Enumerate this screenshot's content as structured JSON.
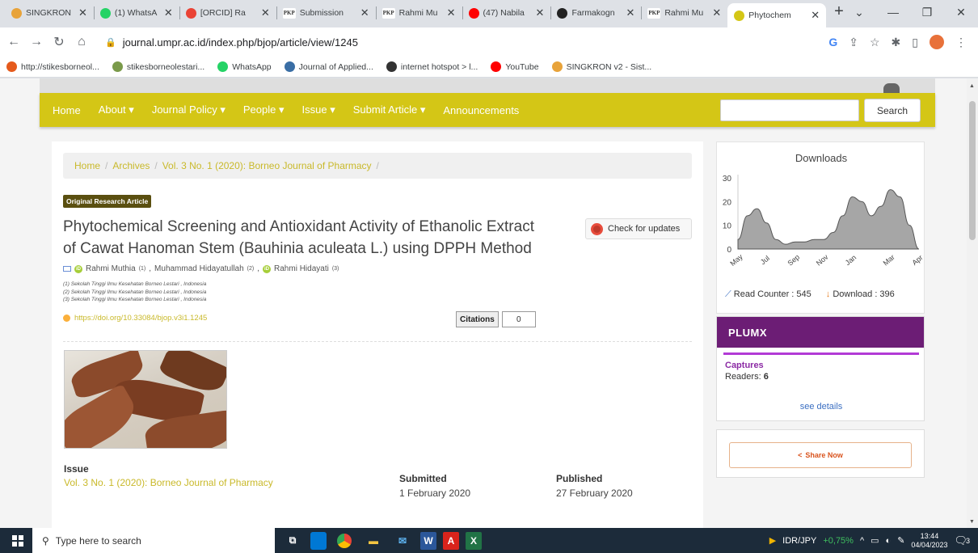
{
  "browser": {
    "tabs": [
      {
        "label": "SINGKRON",
        "icon": "singkron-icon",
        "color": "#e8a33a"
      },
      {
        "label": "(1) WhatsA",
        "icon": "whatsapp-icon",
        "color": "#25d366"
      },
      {
        "label": "[ORCID] Ra",
        "icon": "gmail-icon",
        "color": "#ea4335"
      },
      {
        "label": "Submission",
        "icon": "pkp-icon",
        "color": "#333333"
      },
      {
        "label": "Rahmi Mu",
        "icon": "pkp-icon",
        "color": "#333333"
      },
      {
        "label": "(47) Nabila",
        "icon": "youtube-icon",
        "color": "#ff0000"
      },
      {
        "label": "Farmakogn",
        "icon": "s-icon",
        "color": "#222222"
      },
      {
        "label": "Rahmi Mu",
        "icon": "pkp-icon",
        "color": "#333333"
      },
      {
        "label": "Phytochem",
        "icon": "journal-icon",
        "color": "#d4c616"
      }
    ],
    "url": "journal.umpr.ac.id/index.php/bjop/article/view/1245",
    "bookmarks": [
      {
        "label": "http://stikesborneol...",
        "icon": "cp-icon"
      },
      {
        "label": "stikesborneolestari...",
        "icon": "globe-icon"
      },
      {
        "label": "WhatsApp",
        "icon": "whatsapp-icon"
      },
      {
        "label": "Journal of Applied...",
        "icon": "journal-icon"
      },
      {
        "label": "internet hotspot > l...",
        "icon": "mikrotik-icon"
      },
      {
        "label": "YouTube",
        "icon": "youtube-icon"
      },
      {
        "label": "SINGKRON v2 - Sist...",
        "icon": "singkron-icon"
      }
    ]
  },
  "site": {
    "nav": [
      "Home",
      "About ▾",
      "Journal Policy ▾",
      "People ▾",
      "Issue ▾",
      "Submit Article ▾",
      "Announcements"
    ],
    "search_button": "Search",
    "accent": "#d4c616"
  },
  "article": {
    "breadcrumb": [
      "Home",
      "Archives",
      "Vol. 3 No. 1 (2020): Borneo Journal of Pharmacy"
    ],
    "badge": "Original Research Article",
    "title": "Phytochemical Screening and Antioxidant Activity of Ethanolic Extract of Cawat Hanoman Stem (Bauhinia aculeata L.) using DPPH Method",
    "check_updates": "Check for updates",
    "authors": [
      {
        "name": "Rahmi Muthia",
        "sup": "(1)"
      },
      {
        "name": "Muhammad Hidayatullah",
        "sup": "(2)"
      },
      {
        "name": "Rahmi Hidayati",
        "sup": "(3)"
      }
    ],
    "affiliations": [
      "(1) Sekolah Tinggi Ilmu Kesehatan Borneo Lestari , Indonesia",
      "(2) Sekolah Tinggi Ilmu Kesehatan Borneo Lestari , Indonesia",
      "(3) Sekolah Tinggi Ilmu Kesehatan Borneo Lestari , Indonesia"
    ],
    "doi": "https://doi.org/10.33084/bjop.v3i1.1245",
    "citations_label": "Citations",
    "citations_count": "0",
    "issue_label": "Issue",
    "issue_value": "Vol. 3 No. 1 (2020): Borneo Journal of Pharmacy",
    "submitted_label": "Submitted",
    "submitted_value": "1 February 2020",
    "published_label": "Published",
    "published_value": "27 February 2020"
  },
  "sidebar": {
    "downloads_title": "Downloads",
    "read_counter": "Read Counter : 545",
    "download_count": "Download : 396",
    "plumx_logo": "PLUMX",
    "captures_label": "Captures",
    "readers_label": "Readers:",
    "readers_value": "6",
    "see_details": "see details",
    "share": "Share Now"
  },
  "chart_data": {
    "type": "area",
    "x": [
      "May",
      "Jul",
      "Sep",
      "Nov",
      "Jan",
      "Mar",
      "Apr"
    ],
    "yticks": [
      0,
      10,
      20,
      30
    ],
    "ylim": [
      0,
      30
    ],
    "values": [
      4,
      14,
      17,
      11,
      4,
      2,
      3,
      3,
      4,
      4,
      7,
      14,
      22,
      20,
      14,
      18,
      25,
      22,
      10,
      0
    ],
    "fill": "#a6a6a6",
    "grid": false
  },
  "taskbar": {
    "search_placeholder": "Type here to search",
    "ticker": "IDR/JPY",
    "ticker_change": "+0,75%",
    "time": "13:44",
    "date": "04/04/2023",
    "notif_count": "3"
  }
}
